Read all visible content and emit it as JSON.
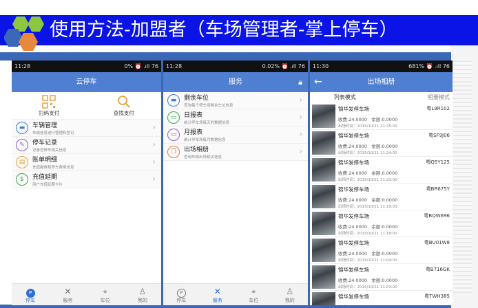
{
  "slide": {
    "title": "使用方法-加盟者（车场管理者-掌上停车）"
  },
  "phone1": {
    "status_time": "11:28",
    "status_right": "0% ⏰ .ıll 76",
    "title": "云停车",
    "pay": [
      {
        "label": "扫码支付",
        "icon": "qr-code-icon"
      },
      {
        "label": "查找支付",
        "icon": "search-icon"
      }
    ],
    "menu": [
      {
        "title": "车辆管理",
        "sub": "车辆信息进行管理和登记",
        "icon": "car-icon",
        "color": "#3a7bd5"
      },
      {
        "title": "停车记录",
        "sub": "记录您停车相关信息",
        "icon": "edit-icon",
        "color": "#8e5bd0"
      },
      {
        "title": "账单明细",
        "sub": "充值缴费和停车费用信息",
        "icon": "bill-icon",
        "color": "#e8a23a"
      },
      {
        "title": "充值延期",
        "sub": "用户充值延期卡片",
        "icon": "dollar-icon",
        "color": "#3aa84a"
      }
    ],
    "tabs": [
      {
        "label": "停车",
        "icon": "parking-icon",
        "active": true
      },
      {
        "label": "服务",
        "icon": "tools-icon",
        "active": false
      },
      {
        "label": "车位",
        "icon": "location-icon",
        "active": false
      },
      {
        "label": "我的",
        "icon": "user-icon",
        "active": false
      }
    ]
  },
  "phone2": {
    "status_time": "11:28",
    "status_right": "0.02% ⏰ .ıll 76",
    "title": "服务",
    "menu": [
      {
        "title": "剩余车位",
        "sub": "查询每个停车场剩余车位信息",
        "icon": "car-icon",
        "color": "#3a7bd5"
      },
      {
        "title": "日报表",
        "sub": "统计停车场每天的数据信息",
        "icon": "report-icon",
        "color": "#3aa84a"
      },
      {
        "title": "月报表",
        "sub": "统计停车场每月数据信息",
        "icon": "report-icon",
        "color": "#8e5bd0"
      },
      {
        "title": "出场相册",
        "sub": "查询车辆出场相关信息",
        "icon": "album-icon",
        "color": "#e07a3a"
      }
    ],
    "tabs": [
      {
        "label": "停车",
        "icon": "parking-icon",
        "active": false
      },
      {
        "label": "服务",
        "icon": "tools-icon",
        "active": true
      },
      {
        "label": "车位",
        "icon": "location-icon",
        "active": false
      },
      {
        "label": "我的",
        "icon": "user-icon",
        "active": false
      }
    ]
  },
  "phone3": {
    "status_time": "11:30",
    "status_right": "681% ⏰ .ıll 76",
    "title": "出场相册",
    "mode_list": "列表模式",
    "mode_album": "相册模式",
    "records": [
      {
        "name": "锦华发停车场",
        "fee": "收费:24.0000",
        "balance": "余额:0.0000",
        "time": "出场时间：2015/10/21 11:25:00",
        "plate": "粤L9R102"
      },
      {
        "name": "锦华发停车场",
        "fee": "收费:24.0000",
        "balance": "余额:0.0000",
        "time": "出场时间：2015/10/21 11:24:00",
        "plate": "粤SF9J06"
      },
      {
        "name": "锦华发停车场",
        "fee": "收费:24.0000",
        "balance": "余额:0.0000",
        "time": "出场时间：2015/10/21 11:23:00",
        "plate": "鄂Q5Y125"
      },
      {
        "name": "锦华发停车场",
        "fee": "收费:24.0000",
        "balance": "余额:0.0000",
        "time": "出场时间：2015/10/21 11:19:00",
        "plate": "粤BR675Y"
      },
      {
        "name": "锦华发停车场",
        "fee": "收费:24.0000",
        "balance": "余额:0.0000",
        "time": "出场时间：2015/10/21 11:18:00",
        "plate": "粤BQW696"
      },
      {
        "name": "锦华发停车场",
        "fee": "收费:24.0000",
        "balance": "余额:0.0000",
        "time": "出场时间：2015/10/21 11:04:00",
        "plate": "粤BU01W8"
      },
      {
        "name": "锦华发停车场",
        "fee": "收费:24.0000",
        "balance": "余额:0.0000",
        "time": "出场时间：2015/10/21 11:03:00",
        "plate": "粤B716GK"
      },
      {
        "name": "锦华发停车场",
        "fee": "收费:24.0000",
        "balance": "余额:0.0000",
        "time": "",
        "plate": "粤TWH385"
      }
    ]
  }
}
